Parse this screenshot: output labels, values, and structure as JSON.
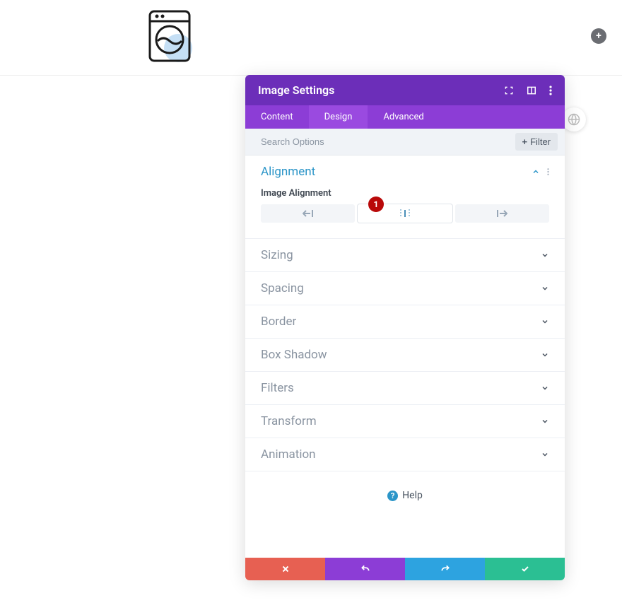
{
  "canvas": {
    "add_label": "+"
  },
  "modal": {
    "title": "Image Settings",
    "tabs": {
      "content": "Content",
      "design": "Design",
      "advanced": "Advanced",
      "active_index": 1
    },
    "search": {
      "placeholder": "Search Options",
      "filter_label": "Filter"
    },
    "sections": {
      "alignment": {
        "title": "Alignment",
        "field_label": "Image Alignment",
        "badge": "1",
        "selected_index": 1
      },
      "sizing": {
        "title": "Sizing"
      },
      "spacing": {
        "title": "Spacing"
      },
      "border": {
        "title": "Border"
      },
      "box_shadow": {
        "title": "Box Shadow"
      },
      "filters": {
        "title": "Filters"
      },
      "transform": {
        "title": "Transform"
      },
      "animation": {
        "title": "Animation"
      }
    },
    "help": {
      "label": "Help",
      "mark": "?"
    }
  },
  "icons": {
    "washer": "washer-icon",
    "add": "plus-icon",
    "globe": "globe-icon",
    "expand_corners": "expand-corners-icon",
    "columns": "columns-icon",
    "kebab": "kebab-icon",
    "chevron_up": "chevron-up-icon",
    "chevron_down": "chevron-down-icon",
    "plus": "plus-icon",
    "align_left": "align-left-icon",
    "align_center": "align-center-icon",
    "align_right": "align-right-icon",
    "close": "close-icon",
    "undo": "undo-icon",
    "redo": "redo-icon",
    "check": "check-icon"
  }
}
